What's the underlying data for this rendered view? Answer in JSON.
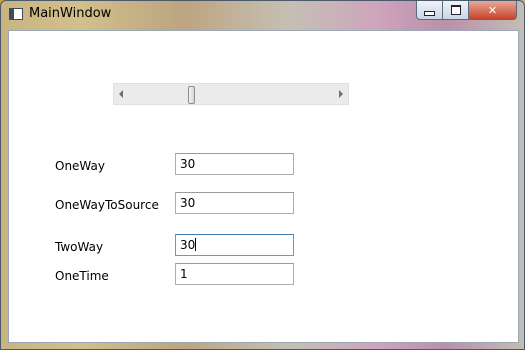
{
  "window": {
    "title": "MainWindow",
    "buttons": [
      "minimize",
      "maximize",
      "close"
    ]
  },
  "slider": {
    "value_fraction": 0.3
  },
  "rows": [
    {
      "label": "OneWay",
      "value": "30"
    },
    {
      "label": "OneWayToSource",
      "value": "30"
    },
    {
      "label": "TwoWay",
      "value": "30"
    },
    {
      "label": "OneTime",
      "value": "1"
    }
  ],
  "icons": {
    "minimize": "minimize-icon",
    "maximize": "maximize-icon",
    "close": "close-icon",
    "slider_left": "arrow-left-icon",
    "slider_right": "arrow-right-icon"
  },
  "colors": {
    "focus_border": "#569de5",
    "close_button": "#c7432a"
  }
}
